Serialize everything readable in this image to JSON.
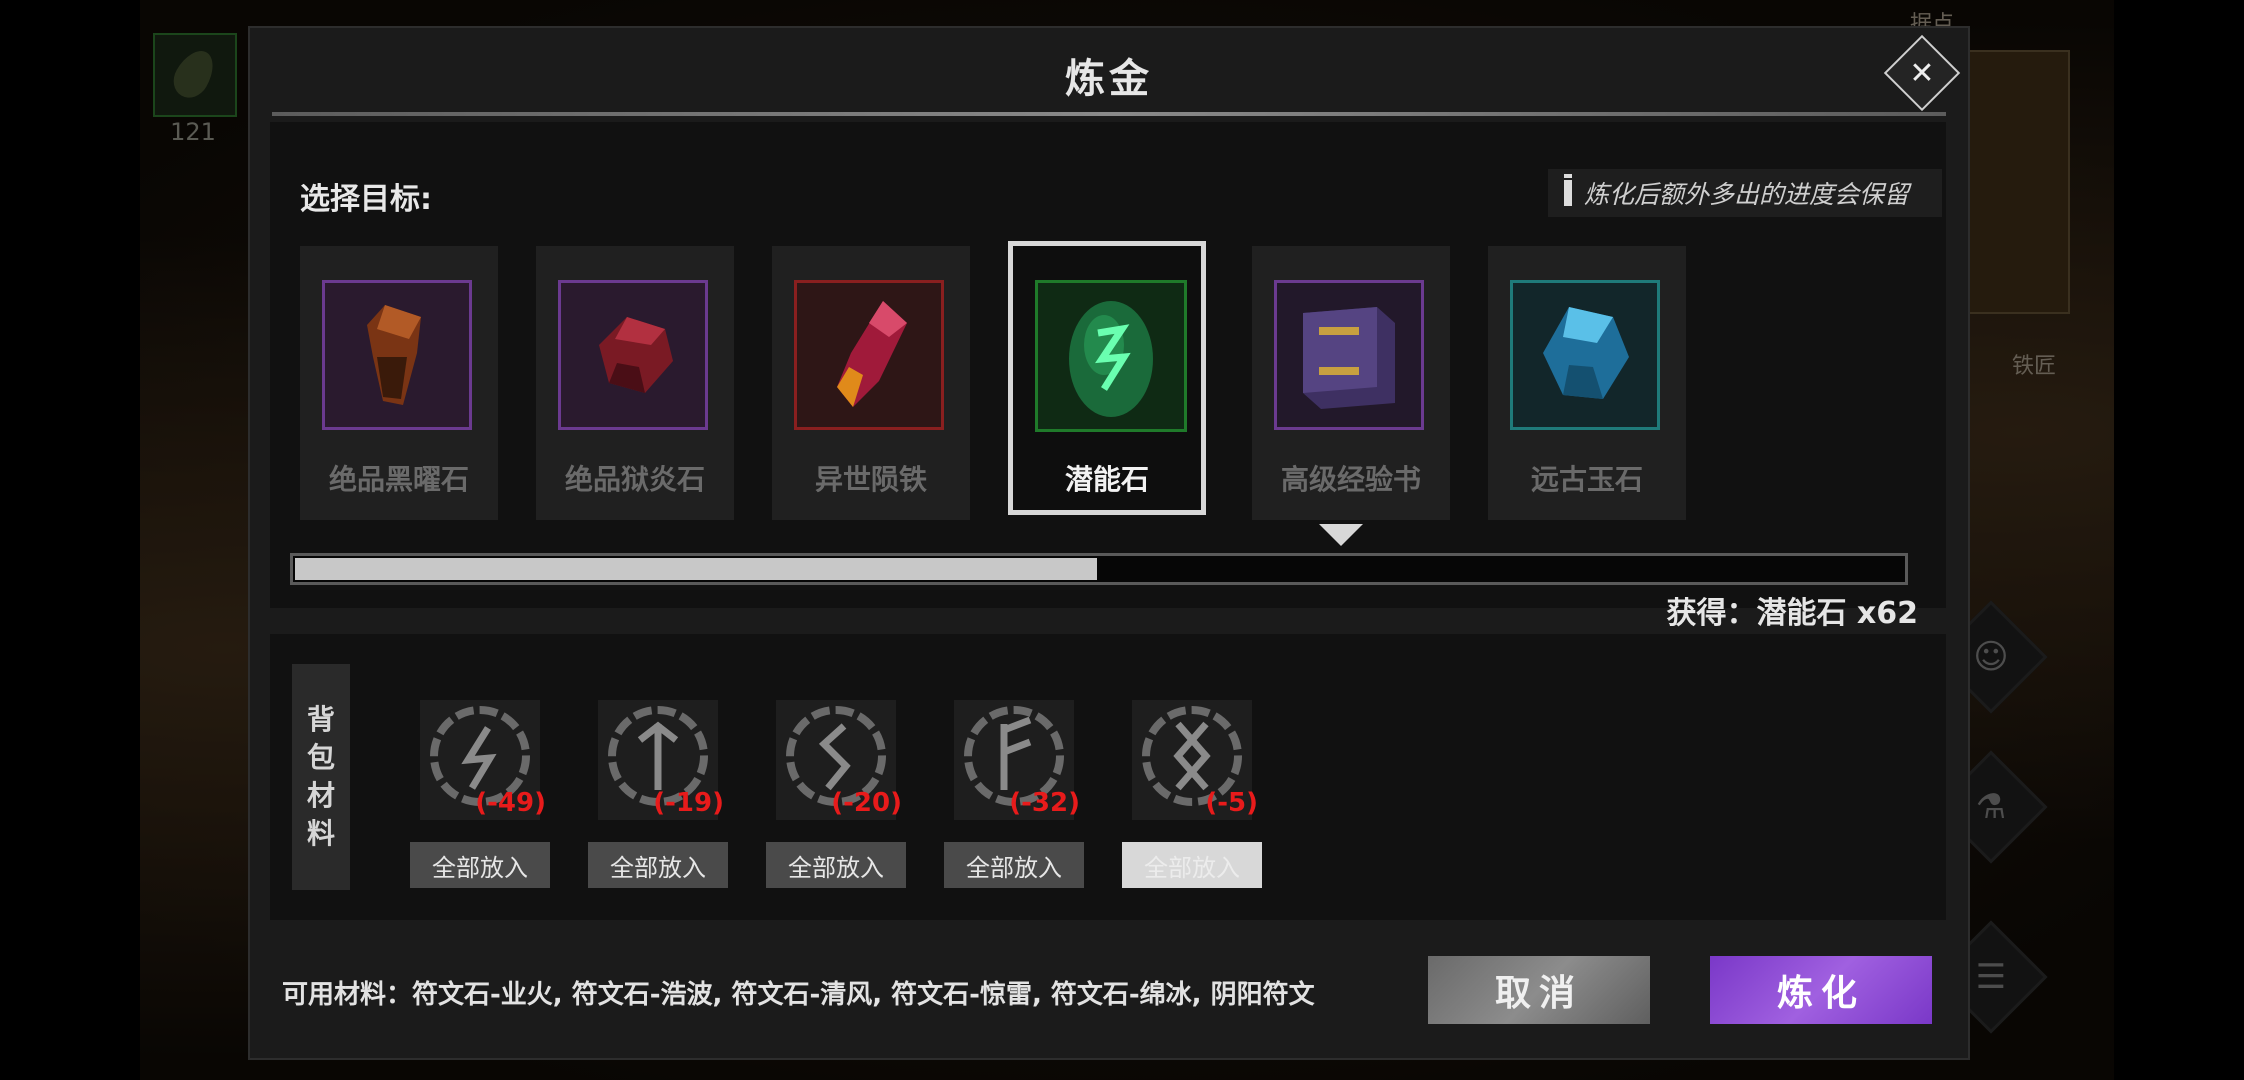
{
  "background": {
    "minimap_count": "121",
    "map_label": "据点",
    "smith_label": "铁匠"
  },
  "dialog": {
    "title": "炼金",
    "close_icon": "close-x",
    "target_label": "选择目标:",
    "hint": "炼化后额外多出的进度会保留",
    "targets": [
      {
        "name": "绝品黑曜石",
        "frame_color": "#6b3a90",
        "icon": "obsidian-icon",
        "selected": false
      },
      {
        "name": "绝品狱炎石",
        "frame_color": "#6b3a90",
        "icon": "hellfire-stone-icon",
        "selected": false
      },
      {
        "name": "异世陨铁",
        "frame_color": "#8a1f1f",
        "icon": "meteor-iron-icon",
        "selected": false
      },
      {
        "name": "潜能石",
        "frame_color": "#1f7a2a",
        "icon": "potential-stone-icon",
        "selected": true
      },
      {
        "name": "高级经验书",
        "frame_color": "#6b3a90",
        "icon": "exp-book-icon",
        "selected": false
      },
      {
        "name": "远古玉石",
        "frame_color": "#1f7a7a",
        "icon": "ancient-jade-icon",
        "selected": false
      }
    ],
    "progress_fraction": 0.5,
    "obtain_text": "获得：潜能石 x62",
    "materials_tab": [
      "背",
      "包",
      "材",
      "料"
    ],
    "materials": [
      {
        "rune": "ϟ",
        "delta": "(-49)",
        "button": "全部放入",
        "enabled": true
      },
      {
        "rune": "ᛏ",
        "delta": "(-19)",
        "button": "全部放入",
        "enabled": true
      },
      {
        "rune": "ᛊ",
        "delta": "(-20)",
        "button": "全部放入",
        "enabled": true
      },
      {
        "rune": "ᚠ",
        "delta": "(-32)",
        "button": "全部放入",
        "enabled": true
      },
      {
        "rune": "ᛝ",
        "delta": "(-5)",
        "button": "全部放入",
        "enabled": false
      }
    ],
    "available_materials": "可用材料：符文石-业火, 符文石-浩波, 符文石-清风, 符文石-惊雷, 符文石-绵冰, 阴阳符文",
    "cancel_label": "取消",
    "refine_label": "炼化"
  }
}
